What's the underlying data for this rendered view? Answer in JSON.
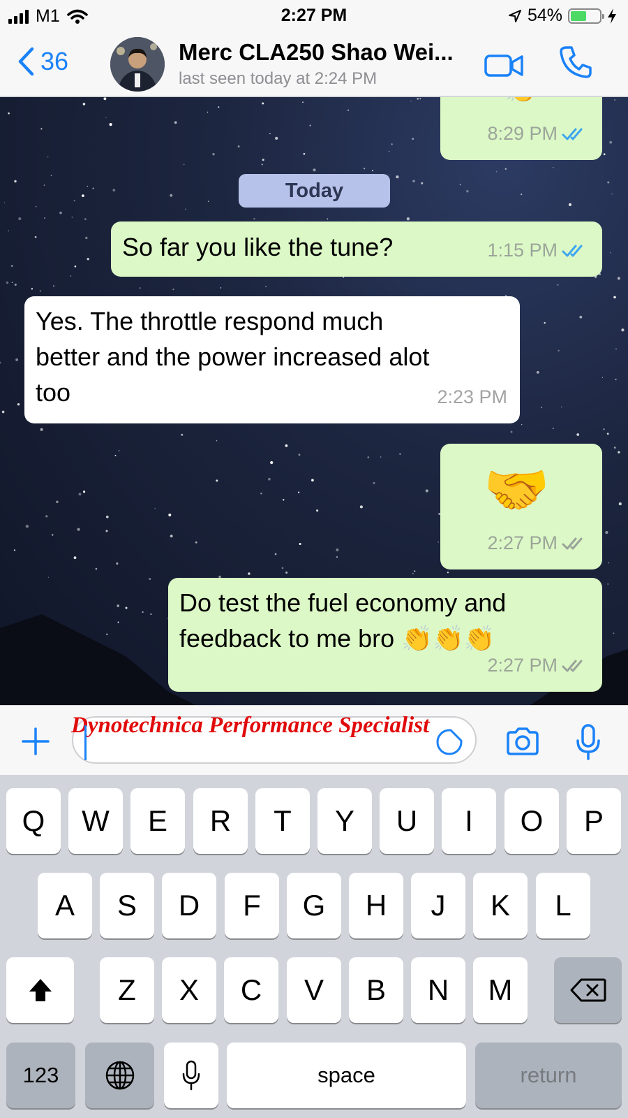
{
  "status_bar": {
    "carrier": "M1",
    "time": "2:27 PM",
    "battery": "54%",
    "battery_level": 0.54
  },
  "header": {
    "back_count": "36",
    "contact_name": "Merc CLA250 Shao Wei...",
    "last_seen": "last seen today at 2:24 PM",
    "icons": [
      "chevron-left-icon",
      "video-call-icon",
      "phone-call-icon"
    ]
  },
  "chat": {
    "top_partial": {
      "time": "8:29 PM",
      "emoji": "👏"
    },
    "date_divider": "Today",
    "messages": [
      {
        "direction": "out",
        "lines": [
          "So far you like the tune?"
        ],
        "time": "1:15 PM",
        "status": "read"
      },
      {
        "direction": "in",
        "lines": [
          "Yes. The throttle respond much",
          "better and the power increased alot",
          "too"
        ],
        "time": "2:23 PM"
      },
      {
        "direction": "out",
        "emoji": "🤝",
        "time": "2:27 PM",
        "status": "delivered"
      },
      {
        "direction": "out",
        "lines": [
          "Do test the fuel economy and",
          "feedback to me bro 👏👏👏"
        ],
        "time": "2:27 PM",
        "status": "delivered"
      }
    ]
  },
  "input": {
    "text": "Dynotechnica Performance Specialist",
    "icons": [
      "plus-icon",
      "sticker-icon",
      "camera-icon",
      "microphone-icon"
    ]
  },
  "keyboard": {
    "row1": [
      "Q",
      "W",
      "E",
      "R",
      "T",
      "Y",
      "U",
      "I",
      "O",
      "P"
    ],
    "row2": [
      "A",
      "S",
      "D",
      "F",
      "G",
      "H",
      "J",
      "K",
      "L"
    ],
    "row3": [
      "Z",
      "X",
      "C",
      "V",
      "B",
      "N",
      "M"
    ],
    "numbers": "123",
    "space": "space",
    "return": "return"
  }
}
